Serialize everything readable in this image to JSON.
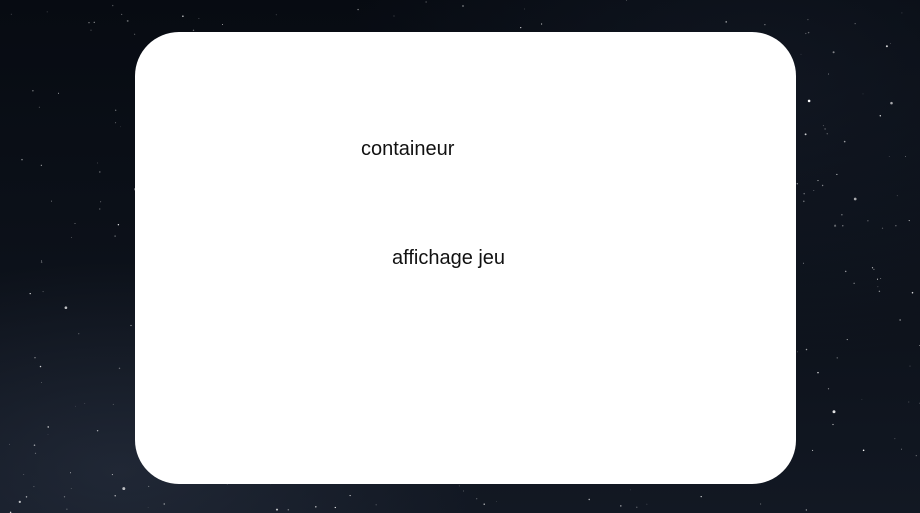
{
  "panel": {
    "container_label": "containeur",
    "game_display_label": "affichage jeu"
  },
  "colors": {
    "background": "#0b0f16",
    "panel": "#ffffff",
    "text": "#111111"
  }
}
